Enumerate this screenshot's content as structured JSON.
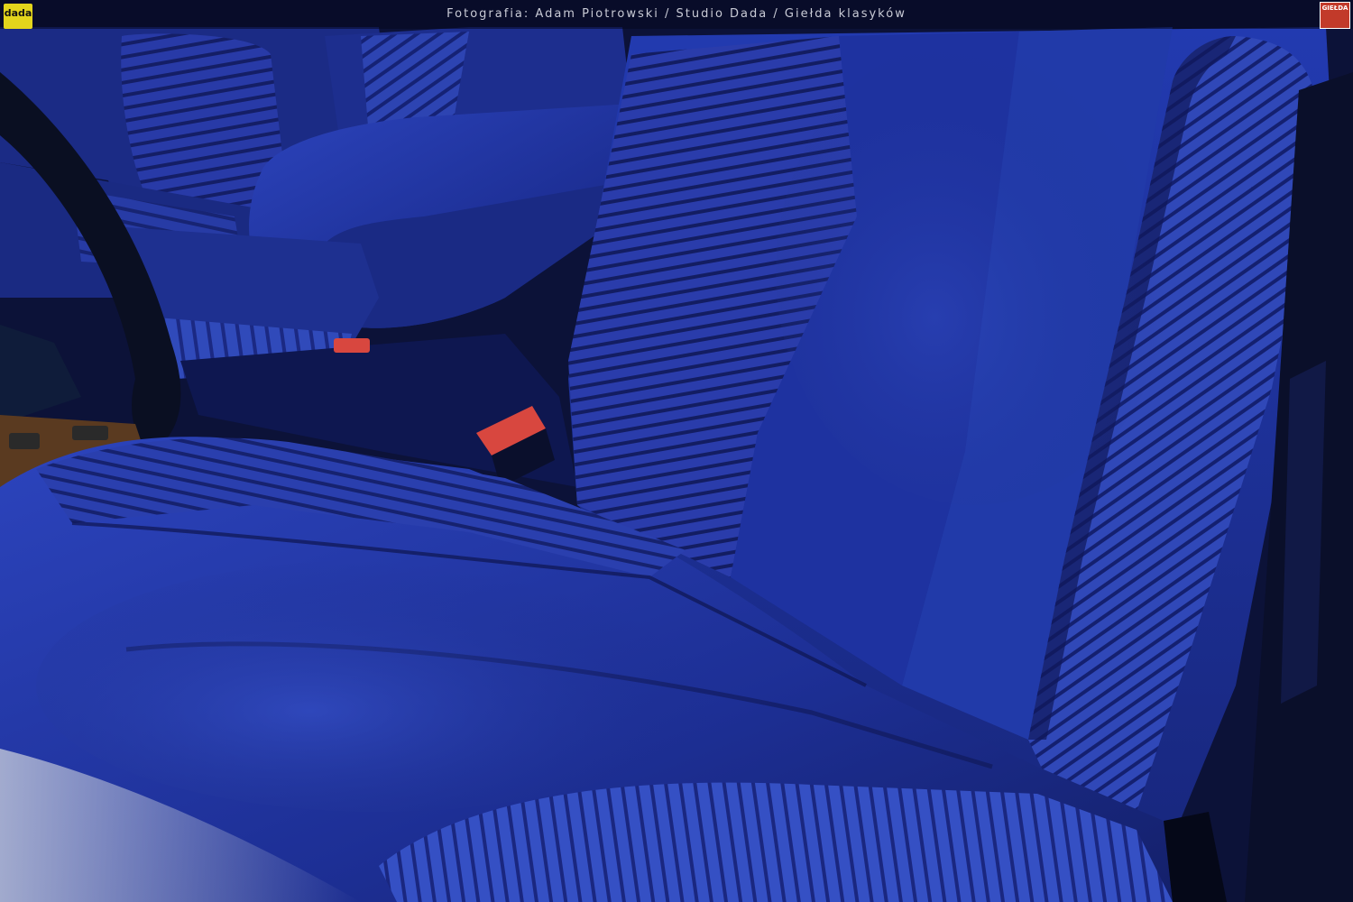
{
  "photo": {
    "caption": "Fotografia: Adam Piotrowski / Studio Dada / Giełda klasyków"
  },
  "logos": {
    "left_text": "dada",
    "right_text": "GIEŁDA"
  },
  "colors": {
    "upholstery": "#22359a",
    "upholstery_light": "#3a55c8",
    "upholstery_dark": "#141f66",
    "rib_line": "#0e1650",
    "buckle": "#d8473f",
    "steering_wheel": "#0a0f22",
    "wood_trim": "#5a3a20"
  }
}
